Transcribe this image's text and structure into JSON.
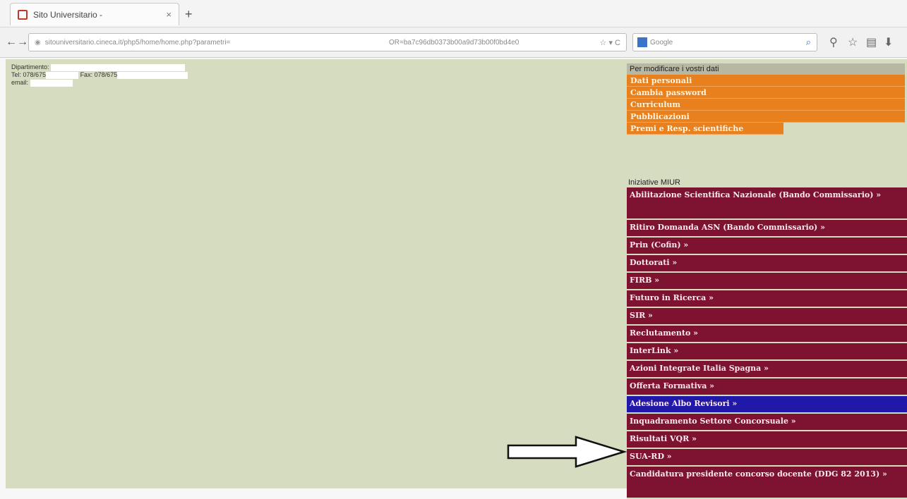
{
  "browser": {
    "tab_title": "Sito Universitario -",
    "tab_close": "×",
    "new_tab": "+",
    "url_part1": "sitouniversitario.cineca.it/php5/home/home.php?parametri=",
    "url_part2": "OR=ba7c96db0373b00a9d73b00f0bd4e0",
    "url_tools": "☆ ▾ C",
    "search_placeholder": "Google",
    "back_icon": "←",
    "forward_icon": "→",
    "colors": {
      "tab_favicon": "#c0392b",
      "search_engine": "#3b73c8"
    }
  },
  "user_info": {
    "dept_label": "Dipartimento:",
    "tel_label": "Tel: 078/675",
    "fax_label": "Fax: 078/675",
    "email_label": "email:"
  },
  "personal_menu": {
    "header": "Per modificare i vostri dati",
    "items": [
      "Dati personali",
      "Cambia password",
      "Curriculum",
      "Pubblicazioni",
      "Premi e Resp. scientifiche"
    ],
    "colors": {
      "header_bg": "#b7b7a3",
      "item_bg": "#e8801e"
    }
  },
  "miur_menu": {
    "header": "Iniziative MIUR",
    "items": [
      "Abilitazione Scientifica Nazionale (Bando Commissario) »",
      "Ritiro Domanda ASN (Bando Commissario) »",
      "Prin (Cofin) »",
      "Dottorati »",
      "FIRB »",
      "Futuro in Ricerca »",
      "SIR »",
      "Reclutamento »",
      "InterLink »",
      "Azioni Integrate Italia Spagna »",
      "Offerta Formativa »",
      "Adesione Albo Revisori »",
      "Inquadramento Settore Concorsuale »",
      "Risultati VQR »",
      "SUA-RD »",
      "Candidatura presidente concorso docente (DDG 82 2013) »"
    ],
    "colors": {
      "item_bg": "#7d1330",
      "highlight_bg": "#1f18a9"
    }
  }
}
